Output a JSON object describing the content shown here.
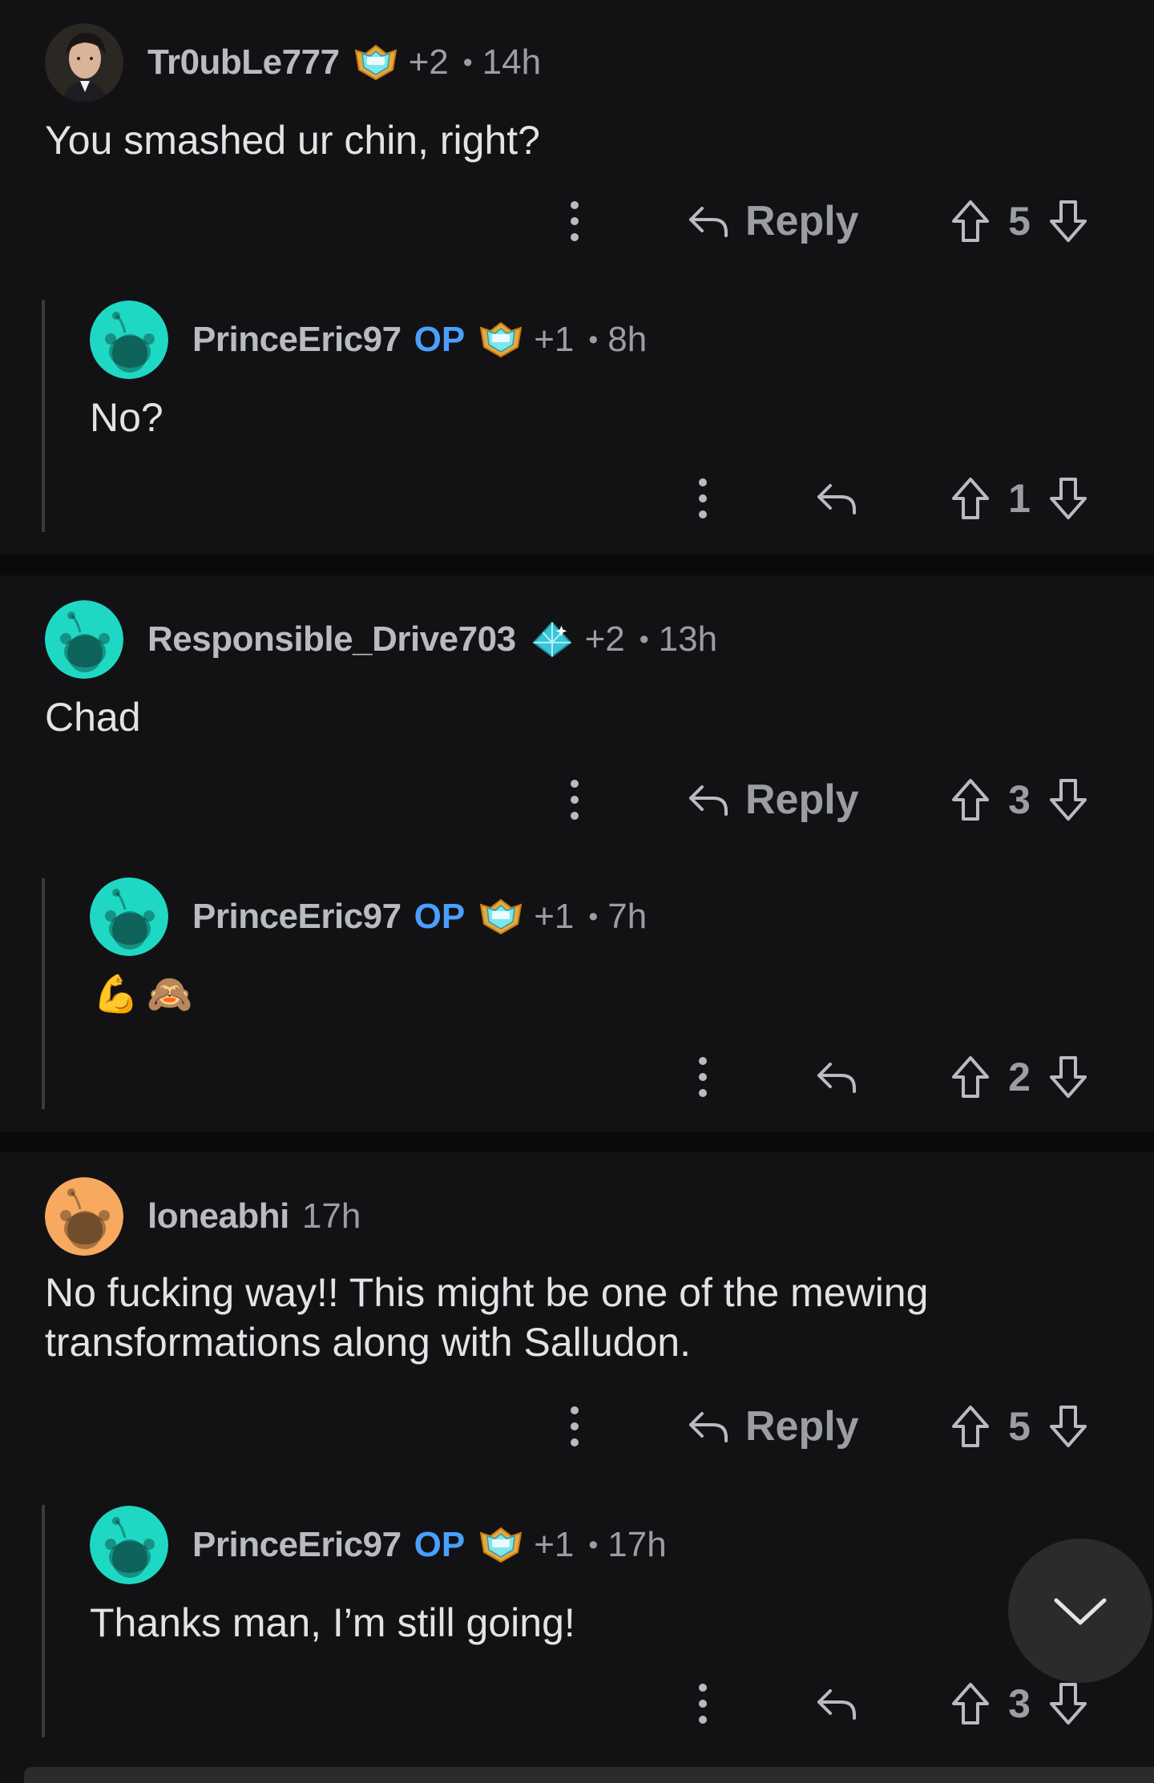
{
  "colors": {
    "background": "#121214",
    "separator": "#0a0a0b",
    "op": "#4a9fff",
    "avatar_teal": "#1fd8c4",
    "avatar_orange": "#f7a95f"
  },
  "threads": [
    {
      "parent": {
        "username": "Tr0ubLe777",
        "awards": "+2",
        "time": "14h",
        "body": "You smashed ur chin, right?",
        "reply_label": "Reply",
        "score": "5"
      },
      "child": {
        "username": "PrinceEric97",
        "op_label": "OP",
        "awards": "+1",
        "time": "8h",
        "body": "No?",
        "score": "1"
      }
    },
    {
      "parent": {
        "username": "Responsible_Drive703",
        "awards": "+2",
        "time": "13h",
        "body": "Chad",
        "reply_label": "Reply",
        "score": "3"
      },
      "child": {
        "username": "PrinceEric97",
        "op_label": "OP",
        "awards": "+1",
        "time": "7h",
        "emojis": [
          "💪",
          "🙈"
        ],
        "score": "2"
      }
    },
    {
      "parent": {
        "username": "loneabhi",
        "time": "17h",
        "body": "No fucking way!! This might be one of the mewing\ntransformations along with Salludon.",
        "reply_label": "Reply",
        "score": "5"
      },
      "child": {
        "username": "PrinceEric97",
        "op_label": "OP",
        "awards": "+1",
        "time": "17h",
        "body": "Thanks man, I’m still going!",
        "score": "3"
      }
    }
  ],
  "icons": {
    "more": "more-vertical-icon",
    "reply": "reply-arrow-icon",
    "upvote": "upvote-arrow-icon",
    "downvote": "downvote-arrow-icon",
    "scroll": "chevron-down-icon"
  }
}
